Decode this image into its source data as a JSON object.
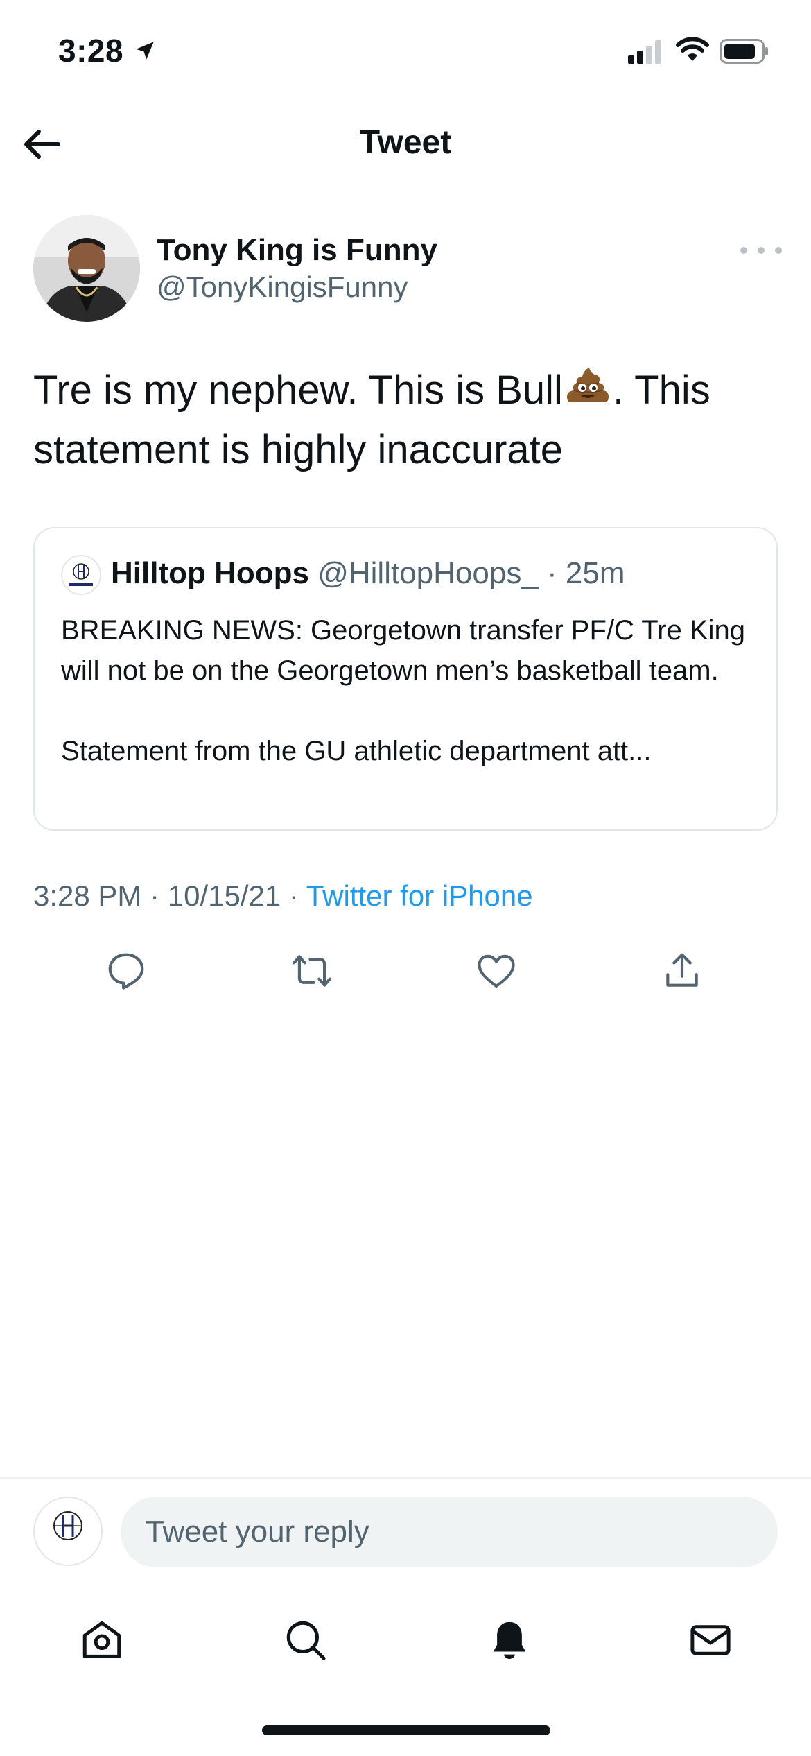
{
  "status_bar": {
    "time": "3:28"
  },
  "header": {
    "title": "Tweet"
  },
  "tweet": {
    "author_name": "Tony King is Funny",
    "author_handle": "@TonyKingisFunny",
    "text_part1": "Tre is my nephew. This is Bull",
    "text_part2": ". This statement is highly inaccurate",
    "timestamp": "3:28 PM · 10/15/21 · ",
    "source": "Twitter for iPhone"
  },
  "quote": {
    "name": "Hilltop Hoops",
    "handle": "@HilltopHoops_",
    "time": "· 25m",
    "line1": "BREAKING NEWS: Georgetown transfer PF/C Tre King will not be on the Georgetown men’s basketball team.",
    "line2": "Statement from the GU athletic department att..."
  },
  "reply": {
    "placeholder": "Tweet your reply",
    "avatar_label": "HILLTOP HOOPS"
  },
  "colors": {
    "accent": "#1d9bf0",
    "secondary_text": "#536471",
    "border": "#e1e6ea",
    "input_bg": "#eff3f4"
  },
  "icons": {
    "actions": [
      "reply-icon",
      "retweet-icon",
      "like-icon",
      "share-icon"
    ],
    "tabs": [
      "home-icon",
      "search-icon",
      "notifications-icon",
      "messages-icon"
    ]
  }
}
